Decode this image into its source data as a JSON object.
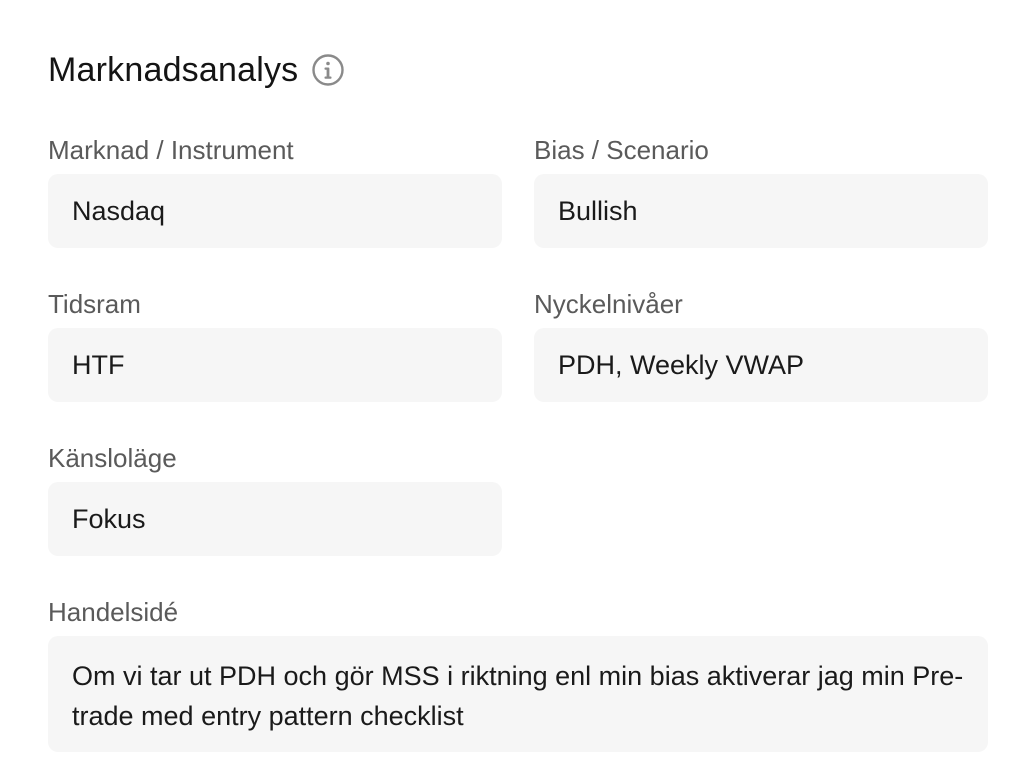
{
  "section": {
    "title": "Marknadsanalys",
    "info_icon": "info-circle-icon"
  },
  "fields": {
    "market": {
      "label": "Marknad / Instrument",
      "value": "Nasdaq"
    },
    "bias": {
      "label": "Bias / Scenario",
      "value": "Bullish"
    },
    "timeframe": {
      "label": "Tidsram",
      "value": "HTF"
    },
    "key_levels": {
      "label": "Nyckelnivåer",
      "value": "PDH, Weekly VWAP"
    },
    "mood": {
      "label": "Känsloläge",
      "value": "Fokus"
    },
    "trade_idea": {
      "label": "Handelsidé",
      "value": "Om vi tar ut PDH och gör MSS i riktning enl min bias aktiverar jag min Pre-trade med entry pattern checklist"
    }
  },
  "colors": {
    "field_background": "#f6f6f6",
    "label_text": "#5a5a5a",
    "value_text": "#1a1a1a"
  }
}
